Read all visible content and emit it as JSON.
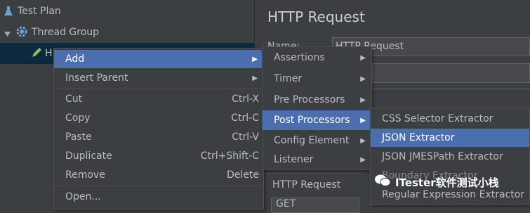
{
  "tree": {
    "items": [
      {
        "label": "Test Plan",
        "icon": "flask-icon"
      },
      {
        "label": "Thread Group",
        "icon": "gear-icon"
      },
      {
        "label": "H",
        "icon": "pencil-icon"
      }
    ]
  },
  "request_panel": {
    "title": "HTTP Request",
    "name_label": "Name:",
    "name_value": "HTTP Request",
    "section_label": "HTTP Request",
    "method_value": "GET"
  },
  "context_menu": {
    "items": [
      {
        "label": "Add",
        "shortcut": "",
        "submenu": true
      },
      {
        "label": "Insert Parent",
        "shortcut": "",
        "submenu": true
      },
      {
        "label": "Cut",
        "shortcut": "Ctrl-X"
      },
      {
        "label": "Copy",
        "shortcut": "Ctrl-C"
      },
      {
        "label": "Paste",
        "shortcut": "Ctrl-V"
      },
      {
        "label": "Duplicate",
        "shortcut": "Ctrl+Shift-C"
      },
      {
        "label": "Remove",
        "shortcut": "Delete"
      },
      {
        "label": "Open..."
      }
    ]
  },
  "add_submenu": {
    "items": [
      {
        "label": "Assertions"
      },
      {
        "label": "Timer"
      },
      {
        "label": "Pre Processors"
      },
      {
        "label": "Post Processors"
      },
      {
        "label": "Config Element"
      },
      {
        "label": "Listener"
      }
    ]
  },
  "post_processors_submenu": {
    "items": [
      {
        "label": "CSS Selector Extractor"
      },
      {
        "label": "JSON Extractor"
      },
      {
        "label": "JSON JMESPath Extractor"
      },
      {
        "label": "Boundary Extractor"
      },
      {
        "label": "Regular Expression Extractor"
      }
    ]
  },
  "watermark": {
    "text": "ITester软件测试小栈"
  },
  "colors": {
    "highlight": "#4b6eaf",
    "background": "#3c3f41",
    "selected_row": "#0d293e"
  }
}
